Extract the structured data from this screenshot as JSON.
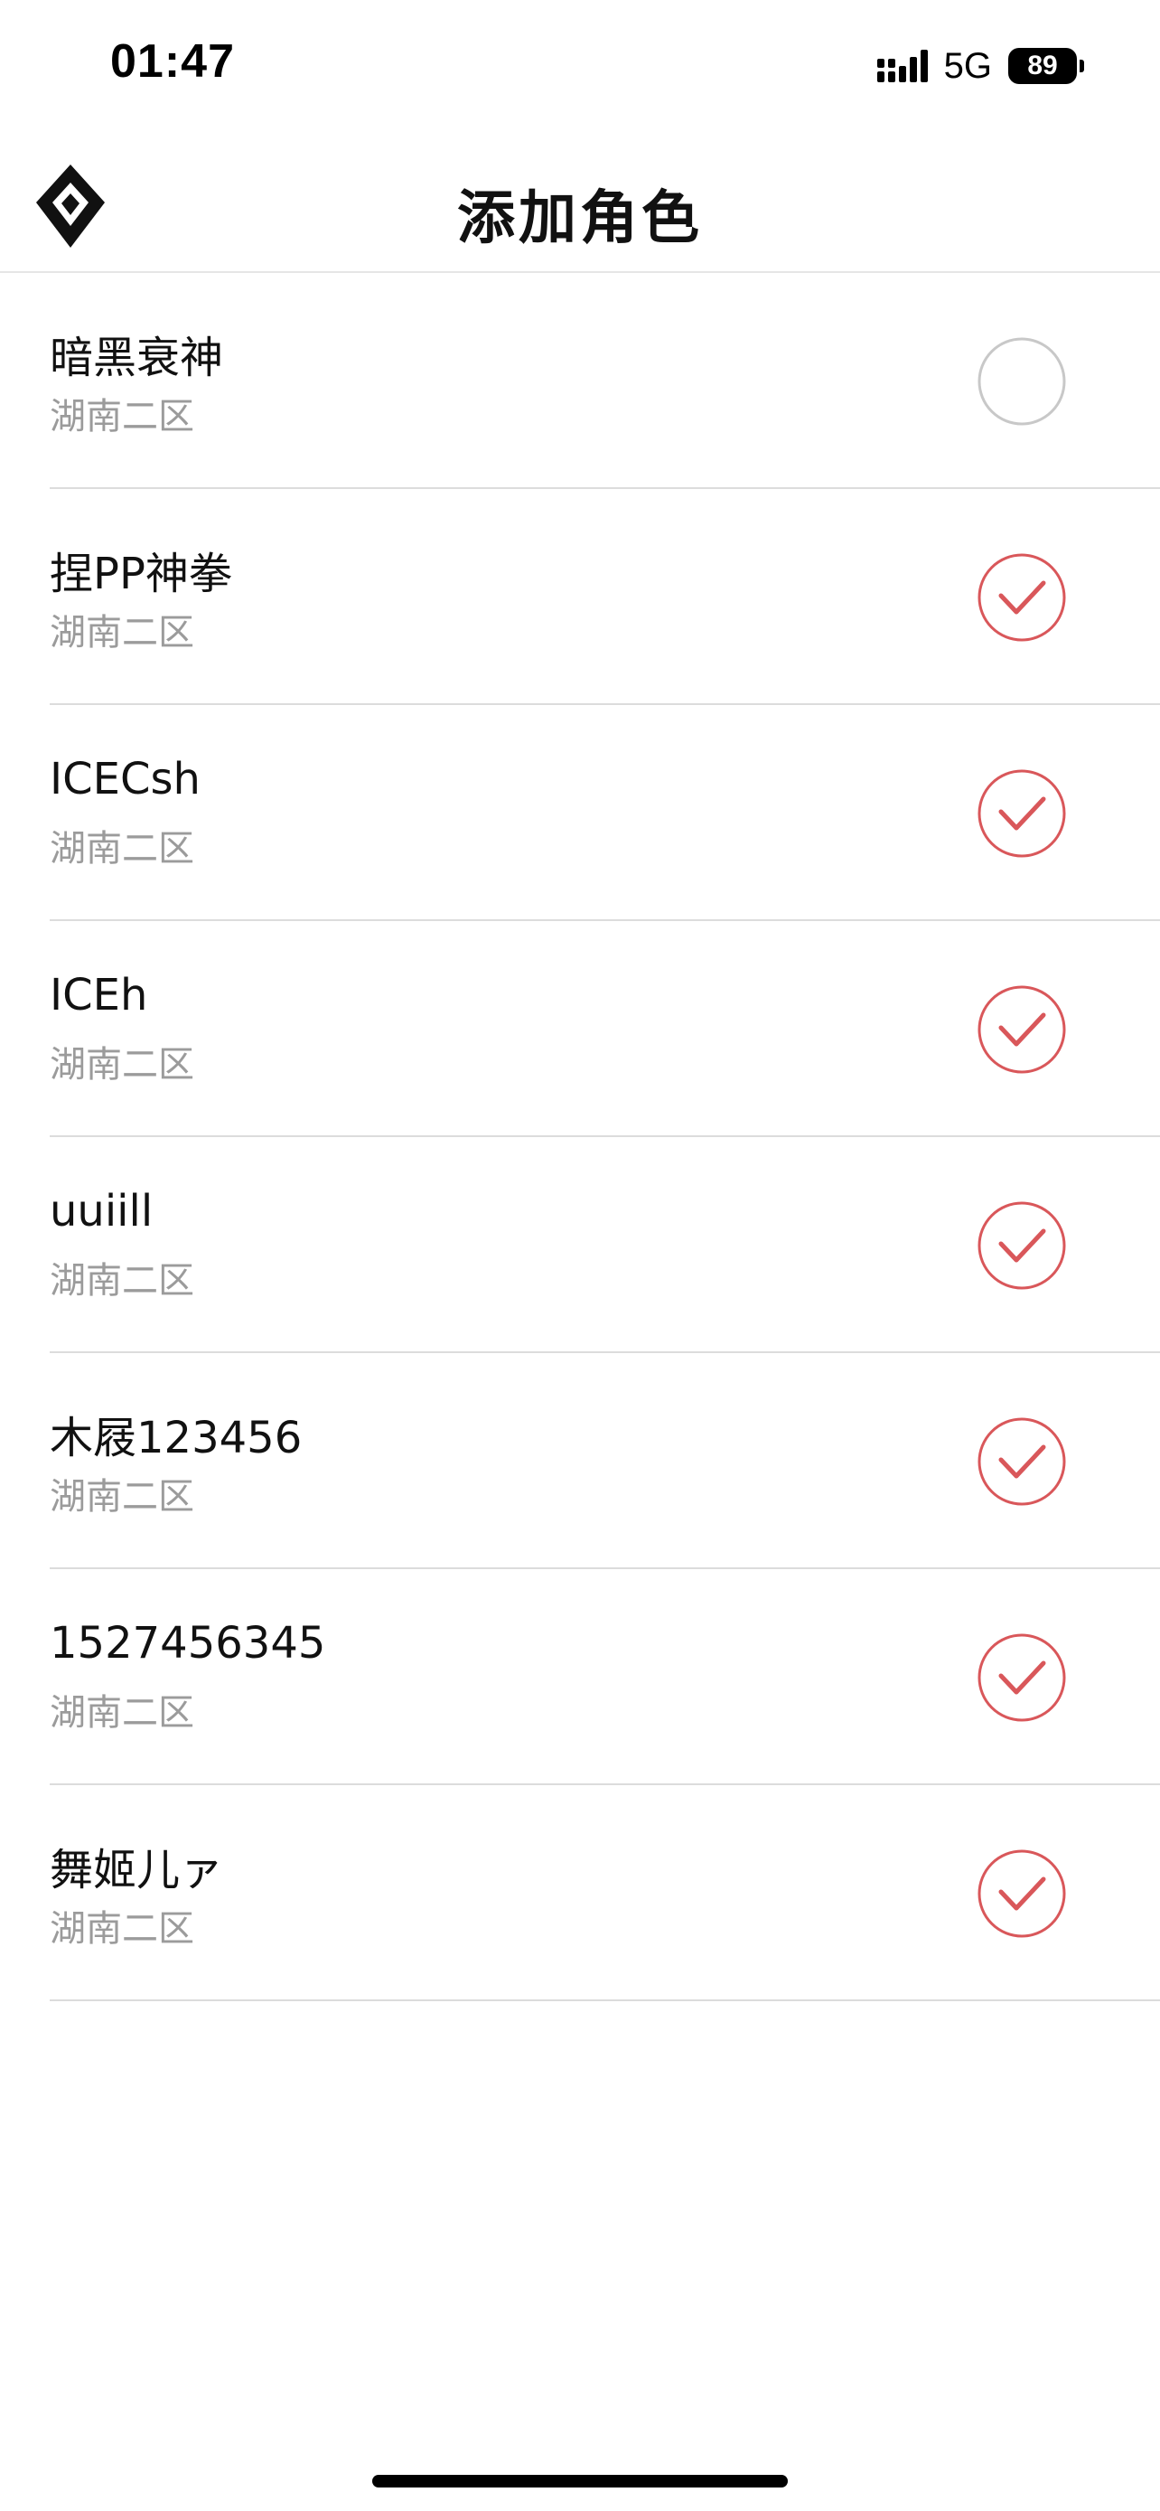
{
  "status_bar": {
    "time": "01:47",
    "network": "5G",
    "battery": "89",
    "icons": {
      "signal": "signal-icon",
      "battery": "battery-icon"
    }
  },
  "header": {
    "title": "添加角色",
    "logo_icon": "diamond-logo-icon"
  },
  "colors": {
    "accent": "#d9575a",
    "unchecked": "#c8c8c8",
    "divider": "#dcdcdc",
    "secondary_text": "#9b9b9b"
  },
  "roles": [
    {
      "name": "暗黑衰神",
      "server": "湖南二区",
      "selected": false
    },
    {
      "name": "捏PP神拳",
      "server": "湖南二区",
      "selected": true
    },
    {
      "name": "ICECsh",
      "server": "湖南二区",
      "selected": true
    },
    {
      "name": "ICEh",
      "server": "湖南二区",
      "selected": true
    },
    {
      "name": "uuiill",
      "server": "湖南二区",
      "selected": true
    },
    {
      "name": "木屐123456",
      "server": "湖南二区",
      "selected": true
    },
    {
      "name": "1527456345",
      "server": "湖南二区",
      "selected": true
    },
    {
      "name": "舞姬儿ァ",
      "server": "湖南二区",
      "selected": true
    }
  ]
}
